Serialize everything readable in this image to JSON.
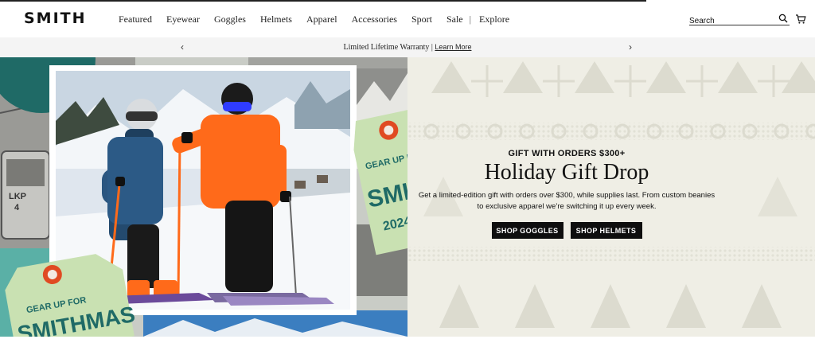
{
  "header": {
    "logo": "SMITH",
    "nav": [
      "Featured",
      "Eyewear",
      "Goggles",
      "Helmets",
      "Apparel",
      "Accessories",
      "Sport",
      "Sale",
      "Explore"
    ],
    "nav_separator": "|",
    "search_placeholder": "Search",
    "icons": {
      "search": "search-icon",
      "cart": "cart-icon"
    }
  },
  "promo": {
    "text": "Limited Lifetime Warranty | ",
    "link": "Learn More",
    "prev": "‹",
    "next": "›"
  },
  "hero": {
    "tag_line1": "GEAR UP FOR",
    "tag_line2": "SMITHMAS",
    "tag_year": "2024",
    "right_tag_line1": "GEAR UP FOR",
    "right_tag_line2": "SMITHMAS",
    "gondola_label_1": "LKP",
    "gondola_label_2": "4",
    "eyebrow": "GIFT WITH ORDERS $300+",
    "title": "Holiday Gift Drop",
    "body": "Get a limited-edition gift with orders over $300, while supplies last. From custom beanies to exclusive apparel we’re switching it up every week.",
    "btn_goggles": "SHOP GOGGLES",
    "btn_helmets": "SHOP HELMETS"
  },
  "colors": {
    "accent_orange": "#ff6a1a",
    "teal": "#1f6a66",
    "tag_green": "#c9e1b2",
    "knit_bg": "#efeee5",
    "button": "#0e0e0e"
  }
}
